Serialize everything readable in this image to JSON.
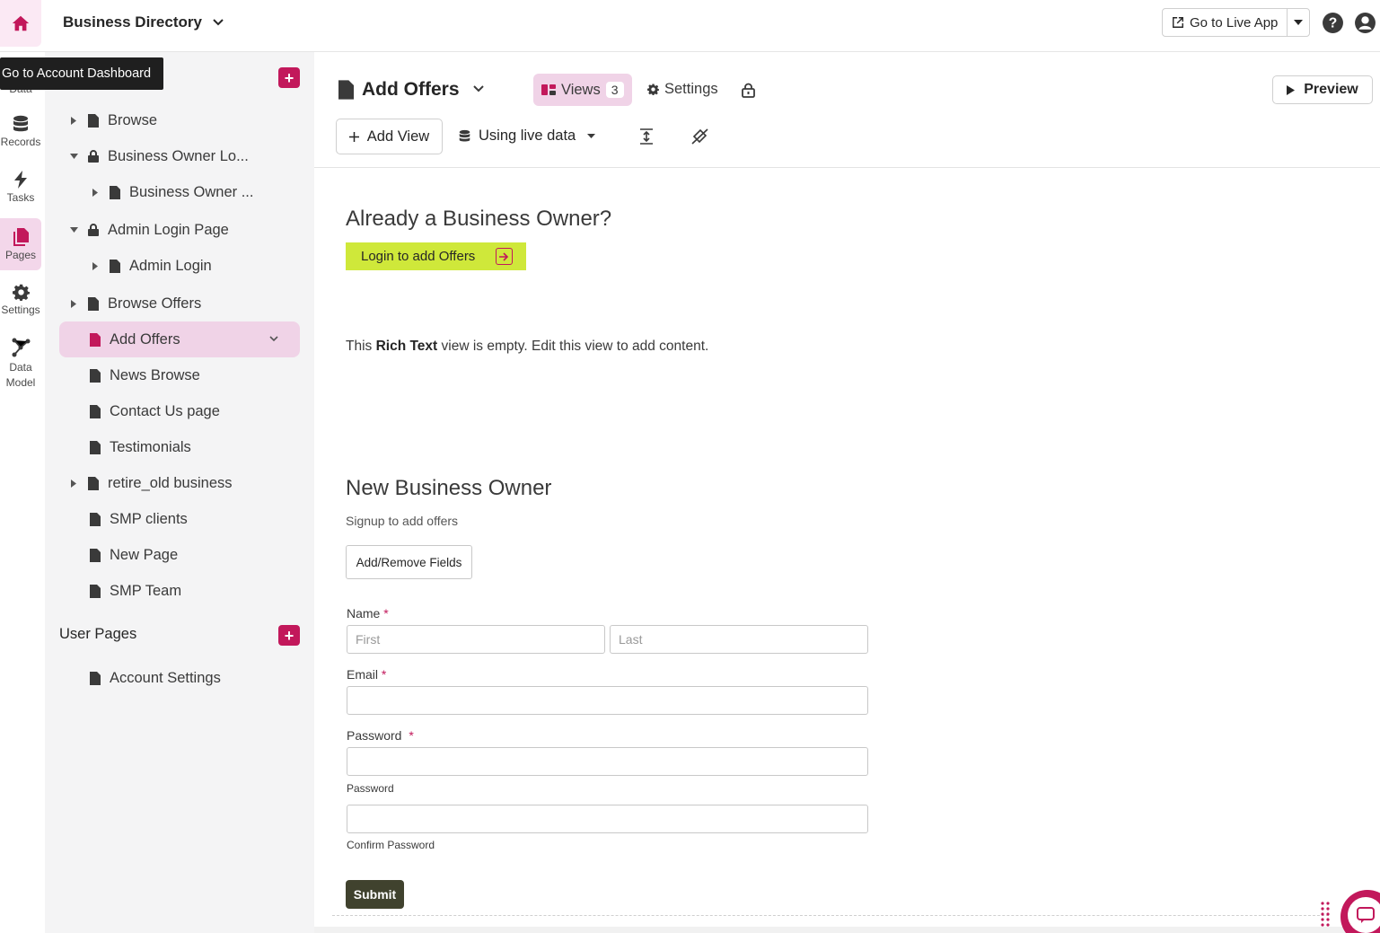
{
  "topbar": {
    "app_title": "Business Directory",
    "go_live_label": "Go to Live App"
  },
  "tooltip": {
    "text": "Go to Account Dashboard"
  },
  "rail": {
    "items": [
      {
        "label": "Data",
        "icon": "data-icon"
      },
      {
        "label": "Records",
        "icon": "database-icon"
      },
      {
        "label": "Tasks",
        "icon": "bolt-icon"
      },
      {
        "label": "Pages",
        "icon": "pages-icon"
      },
      {
        "label": "Settings",
        "icon": "gear-icon"
      },
      {
        "label": "Data Model",
        "icon": "data-model-icon"
      }
    ]
  },
  "sidebar": {
    "pages": [
      {
        "label": "Browse"
      },
      {
        "label": "Business Owner Lo..."
      },
      {
        "label": "Business Owner ..."
      },
      {
        "label": "Admin Login Page"
      },
      {
        "label": "Admin Login"
      },
      {
        "label": "Browse Offers"
      },
      {
        "label": "Add Offers"
      },
      {
        "label": "News Browse"
      },
      {
        "label": "Contact Us page"
      },
      {
        "label": "Testimonials"
      },
      {
        "label": "retire_old business"
      },
      {
        "label": "SMP clients"
      },
      {
        "label": "New Page"
      },
      {
        "label": "SMP Team"
      }
    ],
    "user_pages_title": "User Pages",
    "user_pages": [
      {
        "label": "Account Settings"
      }
    ]
  },
  "page_header": {
    "title": "Add Offers",
    "views_label": "Views",
    "views_count": "3",
    "settings_label": "Settings",
    "preview_label": "Preview",
    "add_view_label": "Add View",
    "live_data_label": "Using live data"
  },
  "content": {
    "login_heading": "Already a Business Owner?",
    "login_button": "Login to add Offers",
    "rich_text_pre": "This ",
    "rich_text_bold": "Rich Text",
    "rich_text_post": " view is empty. Edit this view to add content.",
    "signup_heading": "New Business Owner",
    "signup_subtitle": "Signup to add offers",
    "add_remove_fields": "Add/Remove Fields",
    "name_label": "Name",
    "first_placeholder": "First",
    "last_placeholder": "Last",
    "email_label": "Email",
    "password_label": "Password",
    "password_hint": "Password",
    "confirm_hint": "Confirm Password",
    "required_mark": "*",
    "submit_label": "Submit"
  },
  "colors": {
    "accent": "#c2185b",
    "accent_light": "#f0d3e7",
    "login_button": "#cfe83a",
    "submit_button": "#40422e"
  }
}
